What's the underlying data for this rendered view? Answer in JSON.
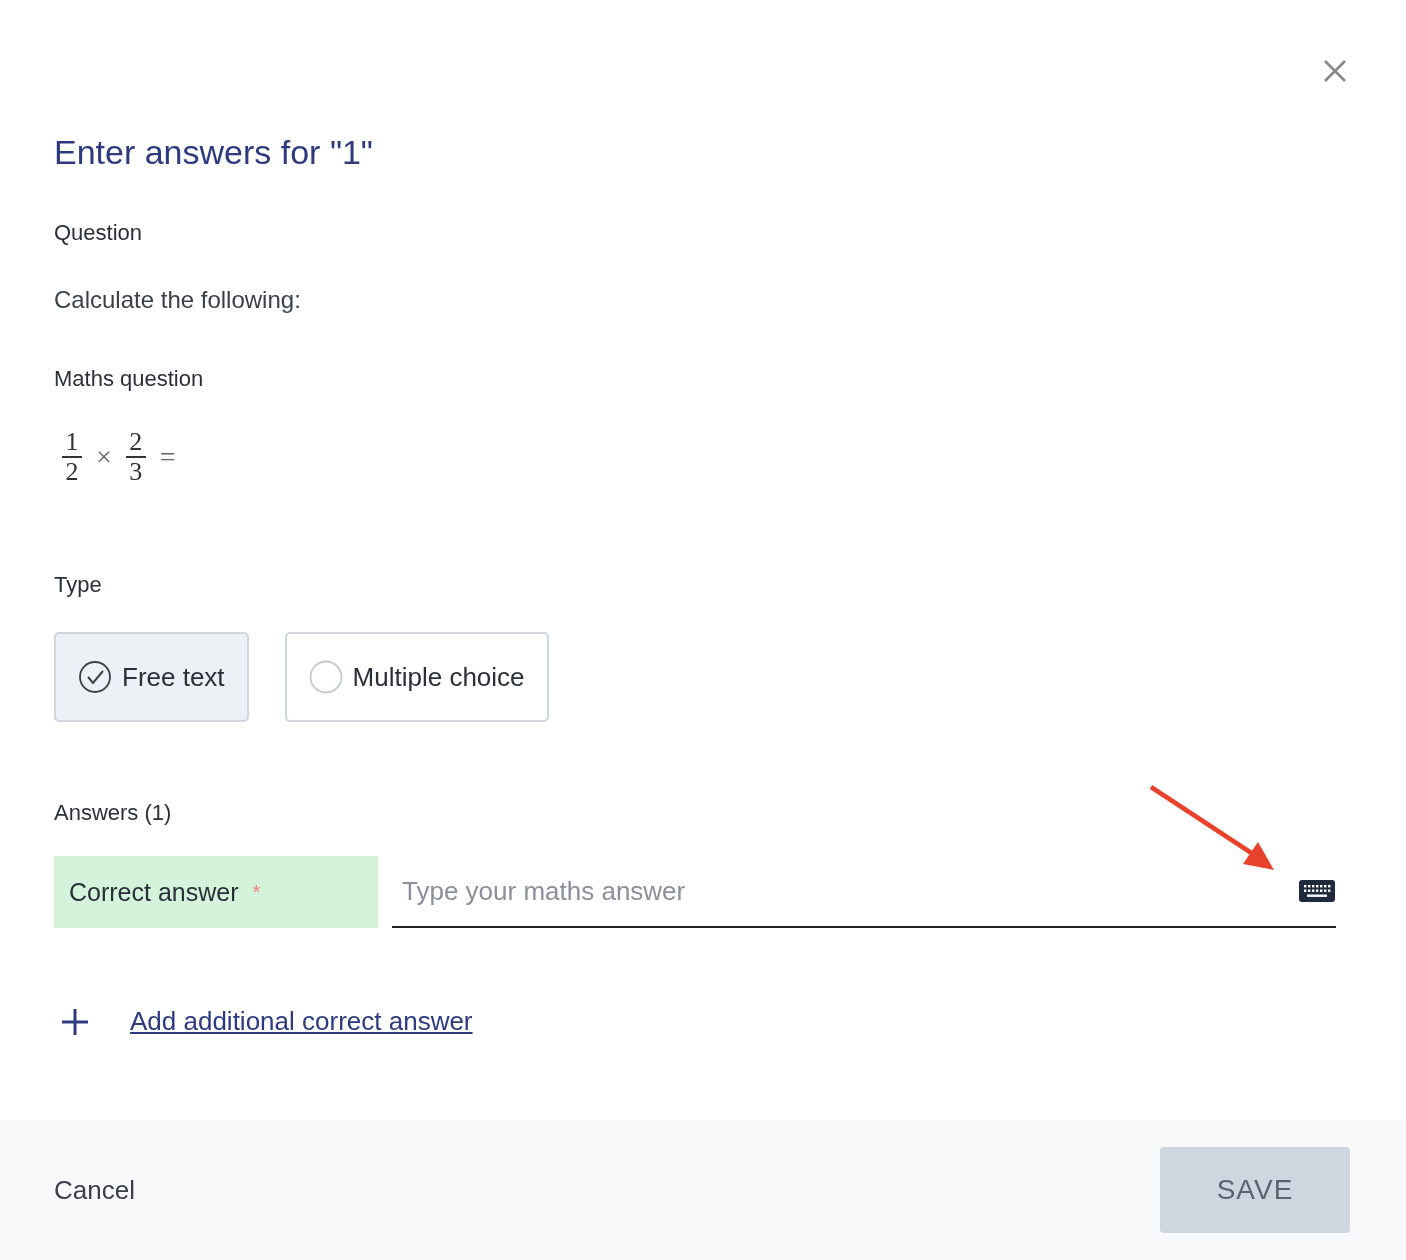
{
  "dialog": {
    "title": "Enter answers for \"1\""
  },
  "question": {
    "label": "Question",
    "text": "Calculate the following:"
  },
  "maths_question": {
    "label": "Maths question",
    "terms": [
      {
        "kind": "fraction",
        "numerator": "1",
        "denominator": "2"
      },
      {
        "kind": "operator",
        "text": "×"
      },
      {
        "kind": "fraction",
        "numerator": "2",
        "denominator": "3"
      },
      {
        "kind": "operator",
        "text": "="
      }
    ]
  },
  "type": {
    "label": "Type",
    "options": [
      {
        "label": "Free text",
        "selected": true
      },
      {
        "label": "Multiple choice",
        "selected": false
      }
    ]
  },
  "answers": {
    "label": "Answers (1)",
    "rows": [
      {
        "label": "Correct answer",
        "required_mark": "*",
        "placeholder": "Type your maths answer"
      }
    ],
    "add_link": "Add additional correct answer"
  },
  "footer": {
    "cancel": "Cancel",
    "save": {
      "label": "SAVE",
      "disabled": true
    }
  }
}
